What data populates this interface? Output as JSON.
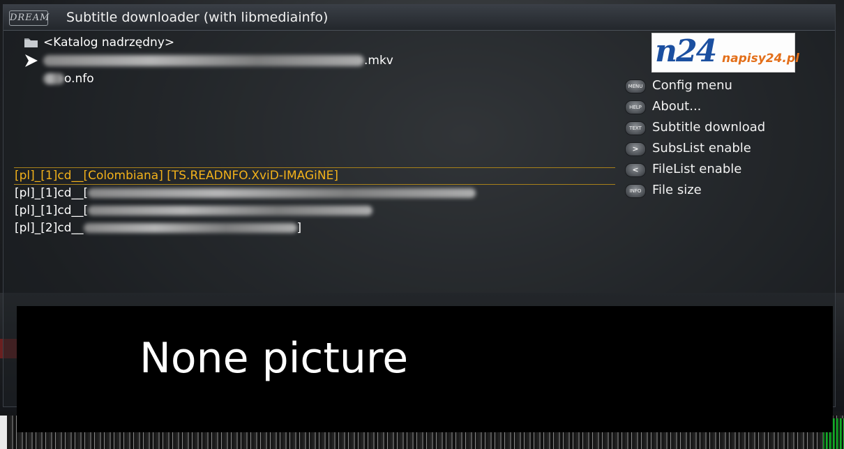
{
  "window": {
    "logo": "DREAM",
    "title": "Subtitle downloader (with libmediainfo)"
  },
  "file_list": {
    "items": [
      {
        "icon": "folder-icon",
        "label": "<Katalog nadrzędny>"
      },
      {
        "icon": "play-arrow-icon",
        "label": ".mkv"
      },
      {
        "icon": "",
        "label": "o.nfo"
      }
    ]
  },
  "subtitles": {
    "items": [
      {
        "prefix": "[pl]_[1]cd__",
        "text": "[Colombiana] [TS.READNFO.XviD-IMAGiNE]",
        "selected": true
      },
      {
        "prefix": "[pl]_[1]cd__[",
        "text": "",
        "selected": false
      },
      {
        "prefix": "[pl]_[1]cd__[",
        "text": "",
        "selected": false
      },
      {
        "prefix": "[pl]_[2]cd__",
        "text": "]",
        "selected": false
      }
    ]
  },
  "brand": {
    "logo_text": "n24",
    "site": "napisy24.pl"
  },
  "menu": {
    "items": [
      {
        "key": "MENU",
        "label": "Config menu"
      },
      {
        "key": "HELP",
        "label": "About..."
      },
      {
        "key": "TEXT",
        "label": "Subtitle download"
      },
      {
        "key": ">",
        "label": "SubsList enable"
      },
      {
        "key": "<",
        "label": "FileList enable"
      },
      {
        "key": "INFO",
        "label": "File size"
      }
    ]
  },
  "picture": {
    "text": "None picture"
  }
}
